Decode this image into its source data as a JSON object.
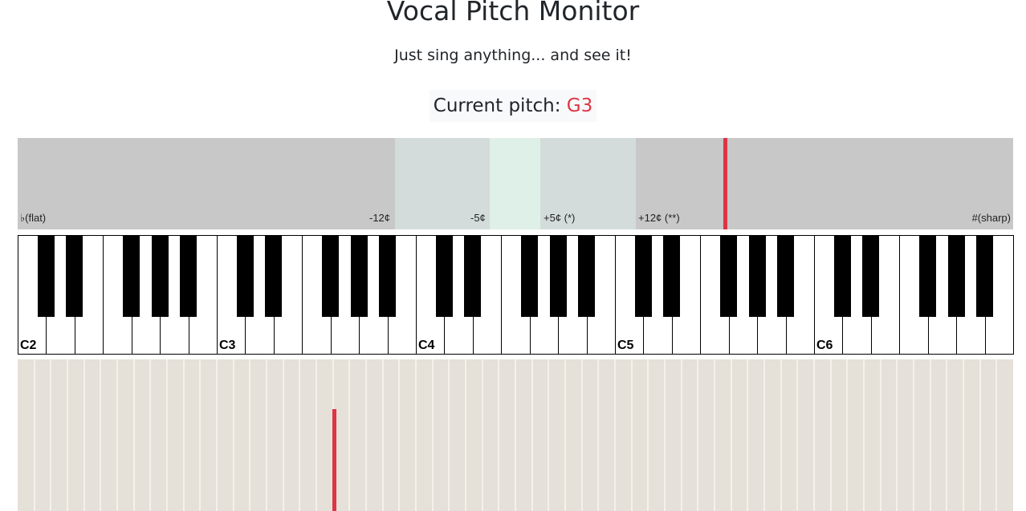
{
  "header": {
    "title": "Vocal Pitch Monitor",
    "subtitle": "Just sing anything... and see it!"
  },
  "pitch": {
    "label": "Current pitch: ",
    "value": "G3"
  },
  "meter": {
    "flat_label": "♭(flat)",
    "minus12_label": "-12¢",
    "minus5_label": "-5¢",
    "plus5_label": "+5¢ (*)",
    "plus12_label": "+12¢ (**)",
    "sharp_label": "#(sharp)",
    "cents_reading": 30
  },
  "keyboard": {
    "octave_labels": [
      "C2",
      "C3",
      "C4",
      "C5",
      "C6"
    ]
  },
  "colors": {
    "accent": "#dc3545",
    "meter_background": "#c8c8c8",
    "zone_outer": "#d3dcda",
    "zone_inner": "#dff0e8",
    "history_background": "#e5e0d8"
  }
}
